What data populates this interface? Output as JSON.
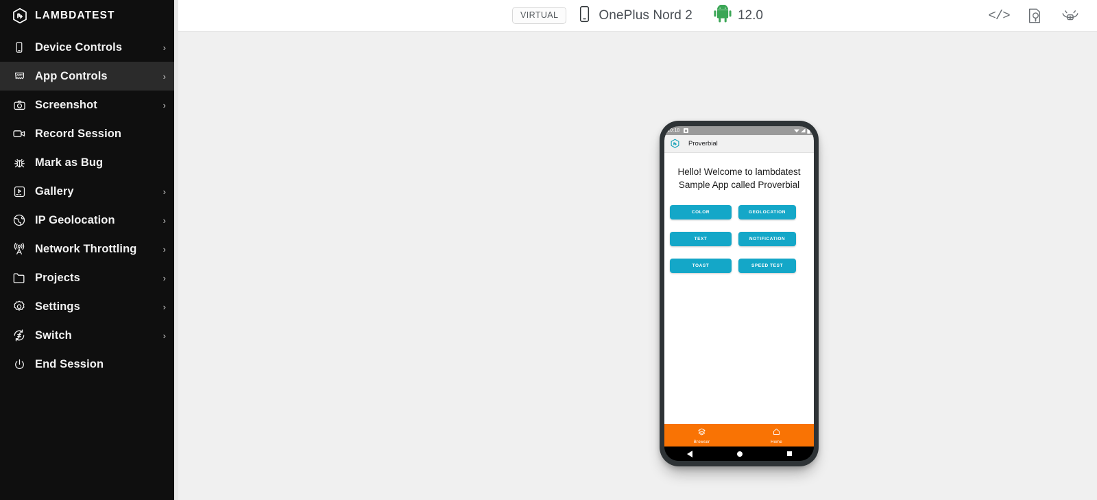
{
  "sidebar": {
    "brand": "LAMBDATEST",
    "brand_icon": "lambdatest-logo-icon",
    "items": [
      {
        "label": "Device Controls",
        "icon": "phone-icon",
        "chevron": "›",
        "active": false
      },
      {
        "label": "App Controls",
        "icon": "app-box-icon",
        "chevron": "›",
        "active": true
      },
      {
        "label": "Screenshot",
        "icon": "camera-icon",
        "chevron": "›",
        "active": false
      },
      {
        "label": "Record Session",
        "icon": "video-icon",
        "chevron": "",
        "active": false
      },
      {
        "label": "Mark as Bug",
        "icon": "bug-icon",
        "chevron": "",
        "active": false
      },
      {
        "label": "Gallery",
        "icon": "gallery-icon",
        "chevron": "›",
        "active": false
      },
      {
        "label": "IP Geolocation",
        "icon": "globe-icon",
        "chevron": "›",
        "active": false
      },
      {
        "label": "Network Throttling",
        "icon": "antenna-icon",
        "chevron": "›",
        "active": false
      },
      {
        "label": "Projects",
        "icon": "folder-icon",
        "chevron": "›",
        "active": false
      },
      {
        "label": "Settings",
        "icon": "gear-icon",
        "chevron": "›",
        "active": false
      },
      {
        "label": "Switch",
        "icon": "switch-icon",
        "chevron": "›",
        "active": false
      },
      {
        "label": "End Session",
        "icon": "power-icon",
        "chevron": "",
        "active": false
      }
    ]
  },
  "topbar": {
    "virtual_badge": "VIRTUAL",
    "device_icon": "mobile-device-icon",
    "device_name": "OnePlus Nord 2",
    "os_icon": "android-robot-icon",
    "os_version": "12.0",
    "right_icons": [
      {
        "name": "code-inspector-icon",
        "glyph": "</>"
      },
      {
        "name": "screenshot-inspect-icon",
        "glyph": ""
      },
      {
        "name": "device-info-icon",
        "glyph": ""
      }
    ]
  },
  "device": {
    "status_bar": {
      "time": "10:18",
      "wifi_icon": "wifi-icon",
      "signal_icon": "signal-icon",
      "battery_icon": "battery-icon"
    },
    "app_bar": {
      "logo_icon": "lambdatest-mark-icon",
      "title": "Proverbial"
    },
    "welcome_text": "Hello! Welcome to lambdatest Sample App called Proverbial",
    "buttons": [
      {
        "label": "COLOR",
        "variant": "primary"
      },
      {
        "label": "GEOLOCATION",
        "variant": "secondary"
      },
      {
        "label": "TEXT",
        "variant": "primary"
      },
      {
        "label": "NOTIFICATION",
        "variant": "secondary"
      },
      {
        "label": "TOAST",
        "variant": "primary"
      },
      {
        "label": "SPEED TEST",
        "variant": "secondary"
      }
    ],
    "bottom_nav": [
      {
        "label": "Browser",
        "icon": "layers-icon"
      },
      {
        "label": "Home",
        "icon": "home-icon"
      }
    ],
    "system_nav": [
      {
        "name": "android-back-button"
      },
      {
        "name": "android-home-button"
      },
      {
        "name": "android-recents-button"
      }
    ]
  },
  "colors": {
    "sidebar_bg": "#0f0f0f",
    "sidebar_active": "#2b2b2b",
    "stage_bg": "#f0f0f0",
    "app_accent": "#14a7c8",
    "bottom_nav": "#f97304",
    "android_green": "#3ddc84"
  }
}
